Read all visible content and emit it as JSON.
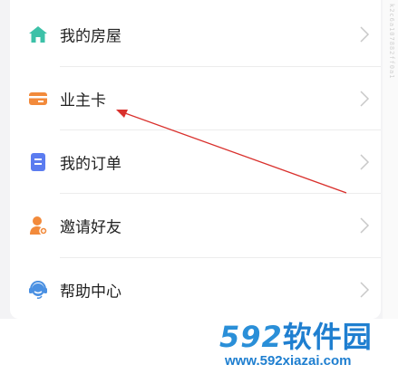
{
  "menu": {
    "items": [
      {
        "label": "我的房屋",
        "icon": "house-icon",
        "color": "#3cc1a8"
      },
      {
        "label": "业主卡",
        "icon": "card-icon",
        "color": "#f28a3b"
      },
      {
        "label": "我的订单",
        "icon": "order-list-icon",
        "color": "#5b7cf0"
      },
      {
        "label": "邀请好友",
        "icon": "invite-friend-icon",
        "color": "#f28a3b"
      },
      {
        "label": "帮助中心",
        "icon": "headset-icon",
        "color": "#4a90e2"
      }
    ]
  },
  "annotation": {
    "arrow_color": "#d9302c"
  },
  "watermark": {
    "side_text": "k2c6a107882ff0a1",
    "logo_number": "592",
    "logo_text": "软件园",
    "url": "www.592xiazai.com"
  }
}
